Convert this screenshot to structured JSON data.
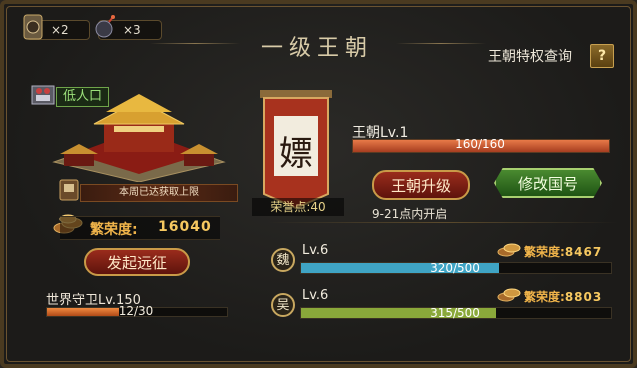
{
  "resources": [
    {
      "icon": "token-icon",
      "count": "×2"
    },
    {
      "icon": "bomb-icon",
      "count": "×3"
    }
  ],
  "title": "一级王朝",
  "privilege_query": {
    "label": "王朝特权查询",
    "help": "?"
  },
  "city": {
    "population_label": "低人口",
    "weekly_notice": "本周已达获取上限",
    "prosperity_label": "繁荣度:",
    "prosperity_value": "16040",
    "expedition_button": "发起远征",
    "world_guard": {
      "label": "世界守卫Lv.150",
      "text": "12/30",
      "progress": 0.4
    }
  },
  "dynasty": {
    "emblem_char": "嫖",
    "honor_points": "荣誉点:40",
    "level_label": "王朝Lv.1",
    "exp_text": "160/160",
    "exp_progress": 1.0,
    "upgrade_button": "王朝升级",
    "rename_button": "修改国号",
    "open_time": "9-21点内开启"
  },
  "kingdoms": [
    {
      "char": "魏",
      "level": "Lv.6",
      "prosperity_label": "繁荣度:",
      "prosperity_value": "8467",
      "text": "320/500",
      "progress": 0.64,
      "color": "#3fa4c4"
    },
    {
      "char": "吴",
      "level": "Lv.6",
      "prosperity_label": "繁荣度:",
      "prosperity_value": "8803",
      "text": "315/500",
      "progress": 0.63,
      "color": "#8aa83a"
    }
  ],
  "colors": {
    "accent_gold": "#f0b44a",
    "exp_red": "#c8502c",
    "guard_orange": "#e0742e"
  }
}
